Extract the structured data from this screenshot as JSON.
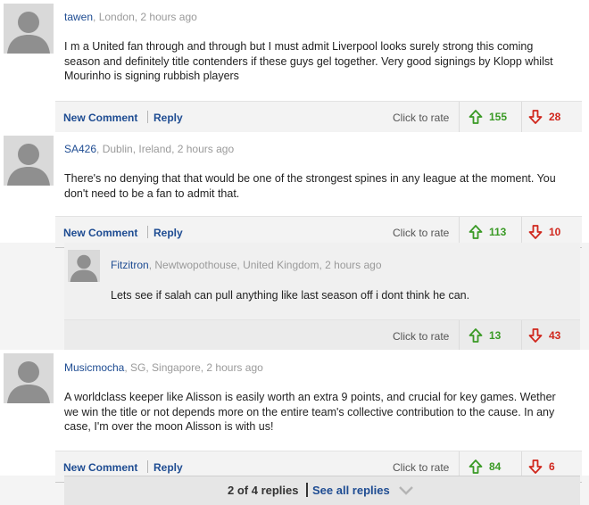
{
  "comments": [
    {
      "author": "tawen",
      "meta": ", London, 2 hours ago",
      "text": "I m a United fan through and through but I must admit Liverpool looks surely strong this coming season and definitely title contenders if these guys gel together. Very good signings by Klopp whilst Mourinho is signing rubbish players",
      "new_comment": "New Comment",
      "reply": "Reply",
      "rate_label": "Click to rate",
      "up": "155",
      "down": "28"
    },
    {
      "author": "SA426",
      "meta": ", Dublin, Ireland, 2 hours ago",
      "text": "There's no denying that that would be one of the strongest spines in any league at the moment. You don't need to be a fan to admit that.",
      "new_comment": "New Comment",
      "reply": "Reply",
      "rate_label": "Click to rate",
      "up": "113",
      "down": "10"
    },
    {
      "author": "Musicmocha",
      "meta": ", SG, Singapore, 2 hours ago",
      "text": "A worldclass keeper like Alisson is easily worth an extra 9 points, and crucial for key games. Wether we win the title or not depends more on the entire team's collective contribution to the cause. In any case, I'm over the moon Alisson is with us!",
      "new_comment": "New Comment",
      "reply": "Reply",
      "rate_label": "Click to rate",
      "up": "84",
      "down": "6"
    }
  ],
  "reply": {
    "author": "Fitzitron",
    "meta": ", Newtwopothouse, United Kingdom, 2 hours ago",
    "text": "Lets see if salah can pull anything like last season off i dont think he can.",
    "rate_label": "Click to rate",
    "up": "13",
    "down": "43"
  },
  "replies_bar": {
    "count": "2 of 4 replies",
    "see_all": "See all replies"
  },
  "colors": {
    "link": "#1e4c92",
    "up": "#3a9a25",
    "down": "#d0271d"
  },
  "icons": {
    "avatar": "user-silhouette-icon",
    "up": "arrow-up-icon",
    "down": "arrow-down-icon",
    "chevron": "chevron-down-icon"
  }
}
